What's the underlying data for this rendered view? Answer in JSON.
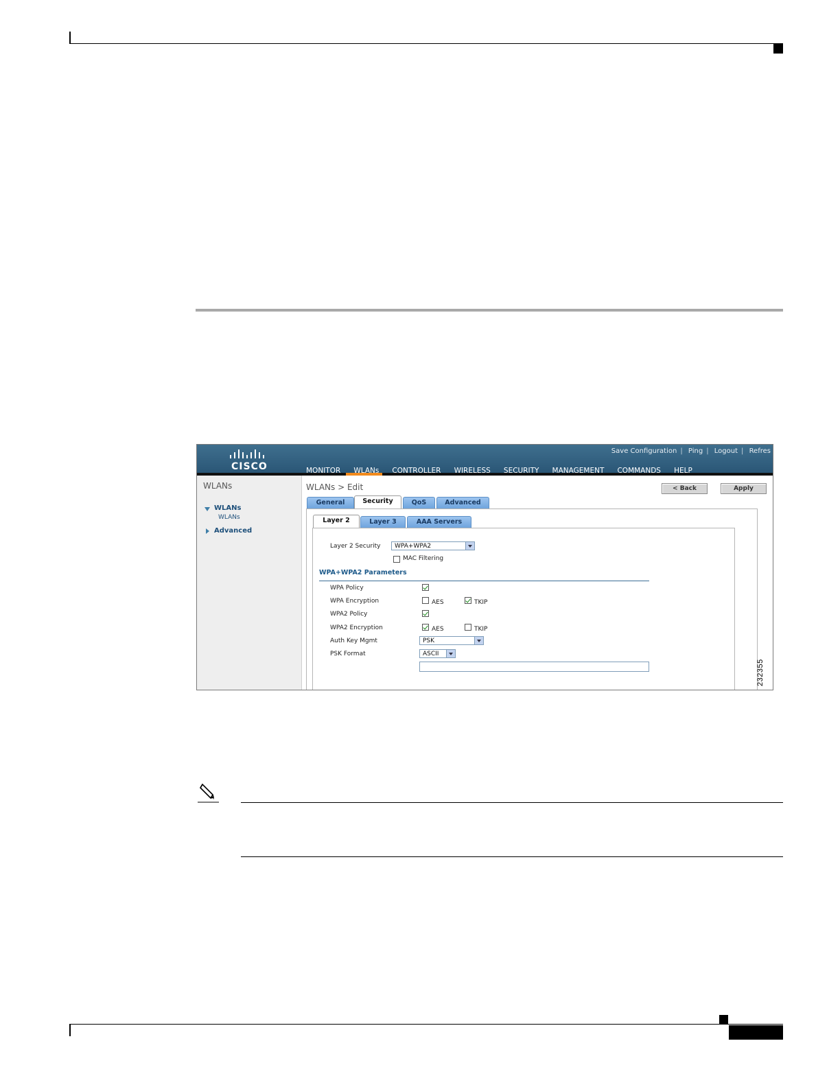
{
  "figure": {
    "number": "232355"
  },
  "app": {
    "logo": "CISCO",
    "top_links": [
      "Save Configuration",
      "Ping",
      "Logout",
      "Refres"
    ],
    "nav": [
      "MONITOR",
      "WLANs",
      "CONTROLLER",
      "WIRELESS",
      "SECURITY",
      "MANAGEMENT",
      "COMMANDS",
      "HELP"
    ],
    "active_nav": "WLANs",
    "accent_color": "#f28a1c",
    "header_color": "#2f5f80"
  },
  "sidebar": {
    "title": "WLANs",
    "items": [
      {
        "label": "WLANs",
        "sub": "WLANs",
        "expanded": true
      },
      {
        "label": "Advanced",
        "expanded": false
      }
    ]
  },
  "page": {
    "title": "WLANs > Edit",
    "back_label": "< Back",
    "apply_label": "Apply"
  },
  "tabs": [
    "General",
    "Security",
    "QoS",
    "Advanced"
  ],
  "active_tab": "Security",
  "subtabs": [
    "Layer 2",
    "Layer 3",
    "AAA Servers"
  ],
  "active_subtab": "Layer 2",
  "form": {
    "layer2_security_label": "Layer 2 Security",
    "layer2_security_value": "WPA+WPA2",
    "mac_filtering_label": "MAC Filtering",
    "mac_filtering_checked": false,
    "params_title": "WPA+WPA2 Parameters",
    "wpa_policy_label": "WPA Policy",
    "wpa_policy_checked": true,
    "wpa_encryption_label": "WPA Encryption",
    "wpa_aes_label": "AES",
    "wpa_aes_checked": false,
    "wpa_tkip_label": "TKIP",
    "wpa_tkip_checked": true,
    "wpa2_policy_label": "WPA2 Policy",
    "wpa2_policy_checked": true,
    "wpa2_encryption_label": "WPA2 Encryption",
    "wpa2_aes_label": "AES",
    "wpa2_aes_checked": true,
    "wpa2_tkip_label": "TKIP",
    "wpa2_tkip_checked": false,
    "auth_key_mgmt_label": "Auth Key Mgmt",
    "auth_key_mgmt_value": "PSK",
    "psk_format_label": "PSK Format",
    "psk_format_value": "ASCII",
    "psk_value": ""
  }
}
